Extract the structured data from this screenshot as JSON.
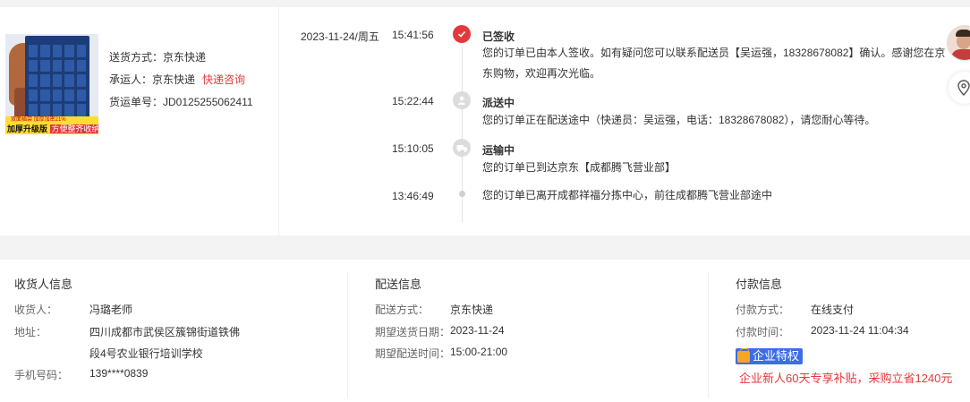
{
  "product": {
    "image_alt": "product thumbnail",
    "banner_top": "双面插袋  加厚加密21%",
    "banner_main": "加厚升级版",
    "banner_highlight": "方便整齐收纳"
  },
  "shipping": {
    "method_label": "送货方式：",
    "method_value": "京东快递",
    "carrier_label": "承运人：",
    "carrier_value": "京东快递",
    "carrier_link": "快递咨询",
    "tracking_label": "货运单号：",
    "tracking_value": "JD0125255062411"
  },
  "timeline": [
    {
      "date": "2023-11-24/周五",
      "time": "15:41:56",
      "title": "已签收",
      "desc": "您的订单已由本人签收。如有疑问您可以联系配送员【吴运强，18328678082】确认。感谢您在京东购物，欢迎再次光临。",
      "icon": "check-icon",
      "active": true
    },
    {
      "date": "",
      "time": "15:22:44",
      "title": "派送中",
      "desc": "您的订单正在配送途中（快递员：吴运强，电话：18328678082），请您耐心等待。",
      "icon": "courier-icon",
      "active": false
    },
    {
      "date": "",
      "time": "15:10:05",
      "title": "运输中",
      "desc": "您的订单已到达京东【成都腾飞营业部】",
      "icon": "truck-icon",
      "active": false
    },
    {
      "date": "",
      "time": "13:46:49",
      "title": "",
      "desc": "您的订单已离开成都祥福分拣中心，前往成都腾飞营业部途中",
      "icon": "dot",
      "active": false
    }
  ],
  "receiver": {
    "title": "收货人信息",
    "name_label": "收货人：",
    "name_value": "冯璐老师",
    "address_label": "地址：",
    "address_line1": "四川成都市武侯区簇锦街道铁佛",
    "address_line2": "段4号农业银行培训学校",
    "phone_label": "手机号码：",
    "phone_value": "139****0839"
  },
  "delivery": {
    "title": "配送信息",
    "method_label": "配送方式：",
    "method_value": "京东快递",
    "date_label": "期望送货日期：",
    "date_value": "2023-11-24",
    "time_label": "期望配送时间：",
    "time_value": "15:00-21:00"
  },
  "payment": {
    "title": "付款信息",
    "method_label": "付款方式：",
    "method_value": "在线支付",
    "time_label": "付款时间：",
    "time_value": "2023-11-24 11:04:34",
    "badge": "企业特权",
    "promo": "企业新人60天专享补贴，采购立省1240元"
  },
  "colors": {
    "accent": "#e4393c",
    "badge_blue": "#3b6de6",
    "badge_icon": "#f5a623"
  }
}
